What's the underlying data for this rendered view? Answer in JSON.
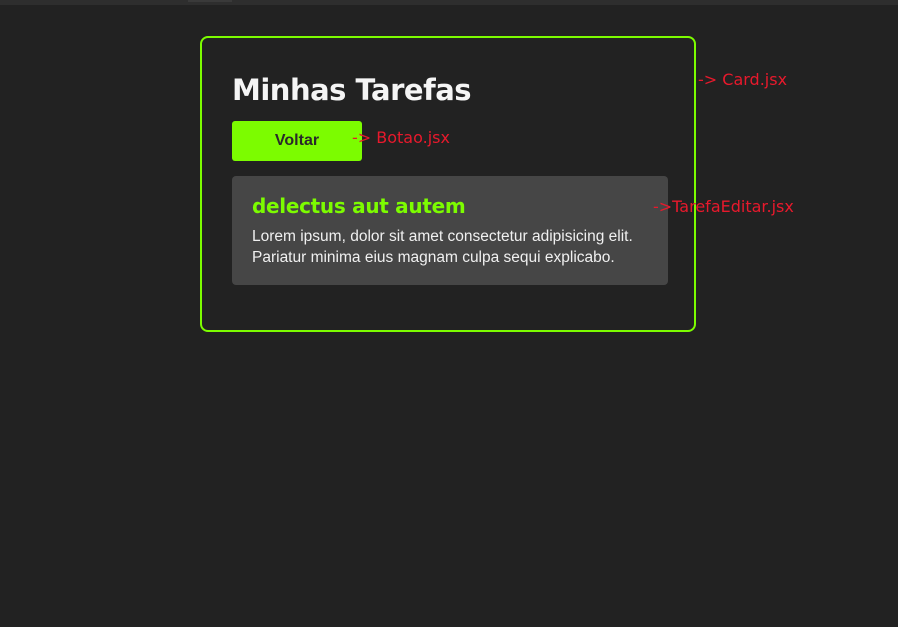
{
  "card": {
    "title": "Minhas Tarefas",
    "back_button_label": "Voltar"
  },
  "task": {
    "title": "delectus aut autem",
    "description": "Lorem ipsum, dolor sit amet consectetur adipisicing elit. Pariatur minima eius magnam culpa sequi explicabo."
  },
  "annotations": {
    "card": "-> Card.jsx",
    "botao": "-> Botao.jsx",
    "tarefa": "->TarefaEditar.jsx"
  },
  "colors": {
    "background": "#222222",
    "accent": "#7cfc00",
    "task_background": "#464646",
    "annotation": "#e8192c"
  }
}
